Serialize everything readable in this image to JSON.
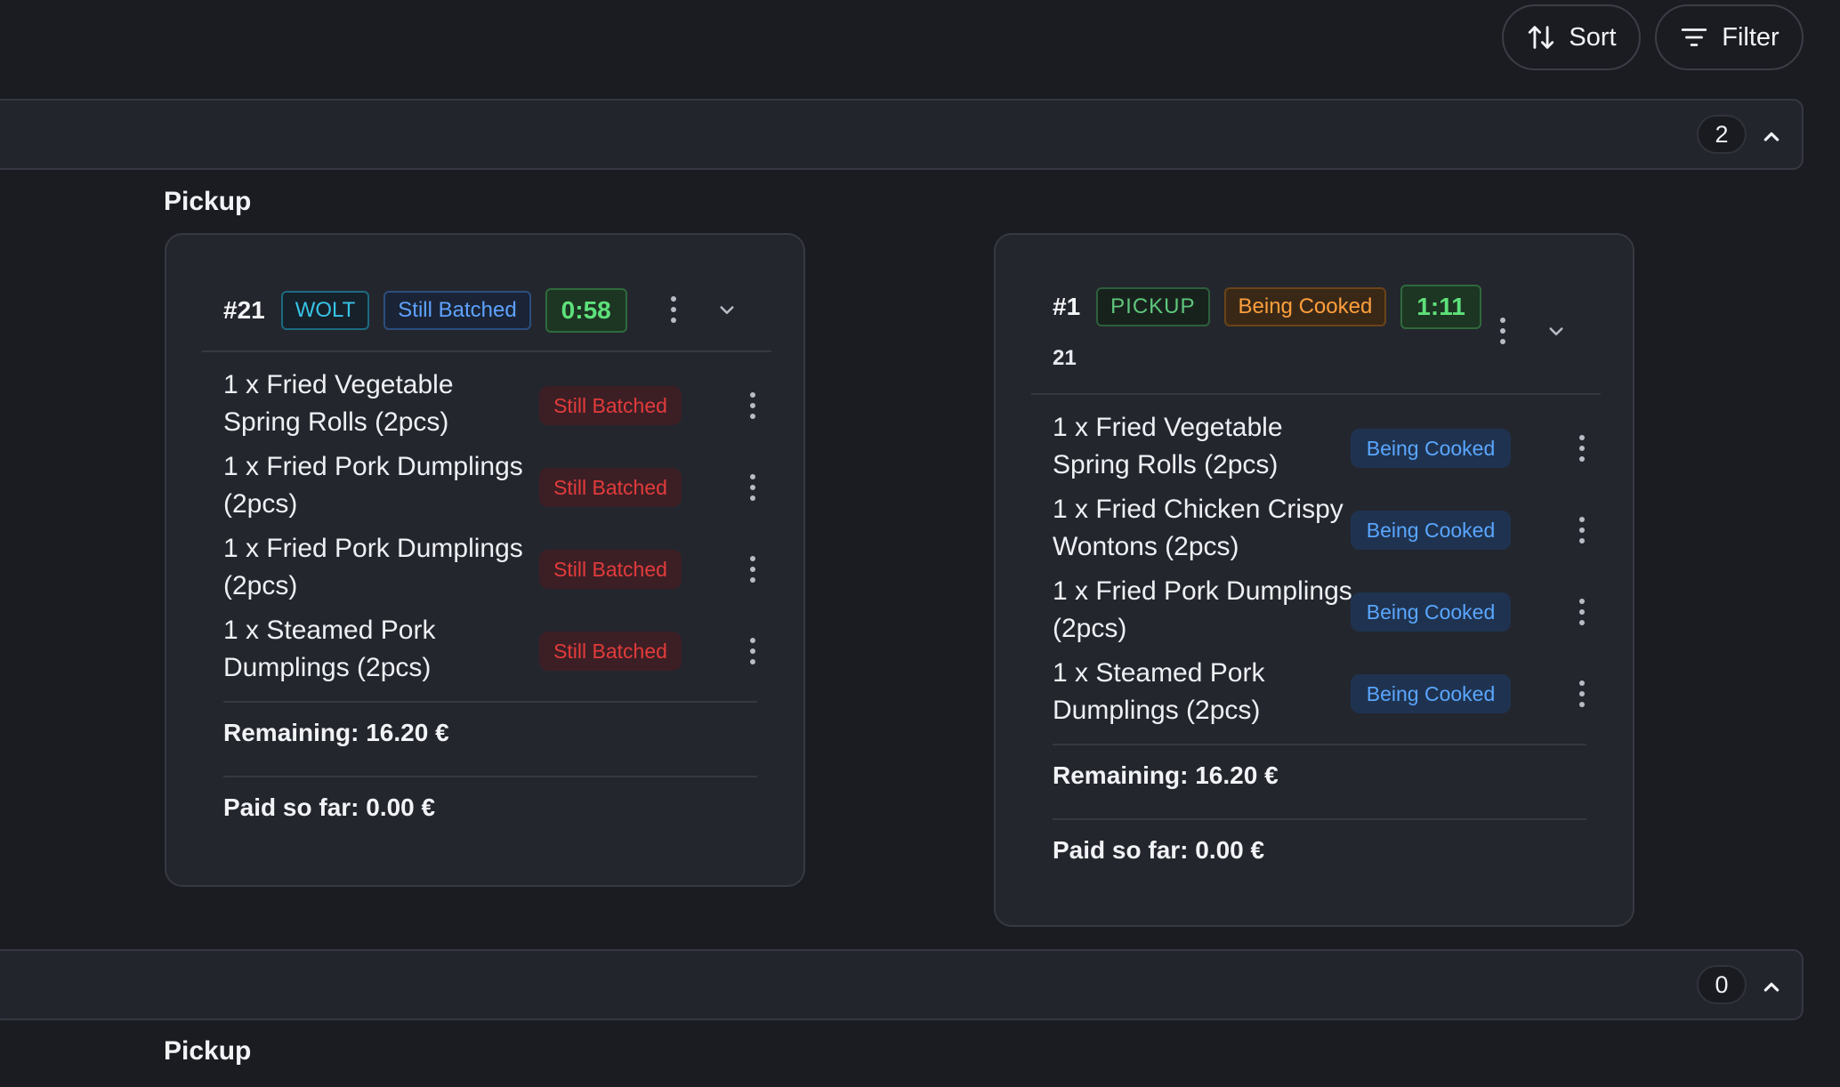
{
  "toolbar": {
    "sort_label": "Sort",
    "filter_label": "Filter"
  },
  "groups": [
    {
      "count": "2",
      "section_title": "Pickup",
      "orders": [
        {
          "number": "#21",
          "source_tag": "WOLT",
          "status_tag": "Still Batched",
          "timer": "0:58",
          "items": [
            {
              "name": "1 x Fried Vegetable Spring Rolls (2pcs)",
              "status": "Still Batched"
            },
            {
              "name": "1 x Fried Pork Dumplings (2pcs)",
              "status": "Still Batched"
            },
            {
              "name": "1 x Fried Pork Dumplings (2pcs)",
              "status": "Still Batched"
            },
            {
              "name": "1 x Steamed Pork Dumplings (2pcs)",
              "status": "Still Batched"
            }
          ],
          "remaining": "Remaining: 16.20 €",
          "paid": "Paid so far: 0.00 €"
        },
        {
          "number": "#1",
          "sub": "21",
          "source_tag": "PICKUP",
          "status_tag": "Being Cooked",
          "timer": "1:11",
          "items": [
            {
              "name": "1 x Fried Vegetable Spring Rolls (2pcs)",
              "status": "Being Cooked"
            },
            {
              "name": "1 x Fried Chicken Crispy Wontons (2pcs)",
              "status": "Being Cooked"
            },
            {
              "name": "1 x Fried Pork Dumplings (2pcs)",
              "status": "Being Cooked"
            },
            {
              "name": "1 x Steamed Pork Dumplings (2pcs)",
              "status": "Being Cooked"
            }
          ],
          "remaining": "Remaining: 16.20 €",
          "paid": "Paid so far: 0.00 €"
        }
      ]
    },
    {
      "count": "0",
      "section_title": "Pickup"
    }
  ],
  "icons": {
    "sort": "sort-arrows-icon",
    "filter": "filter-lines-icon",
    "more": "kebab-menu-icon",
    "collapse": "chevron-up-icon",
    "expand": "chevron-down-icon"
  },
  "colors": {
    "background": "#1b1c22",
    "card": "#24262e",
    "wolt": "#38c3e6",
    "pickup": "#5ec77c",
    "batched_blue": "#5ea2ff",
    "batched_red": "#e23b3b",
    "cooking_orange": "#ff9f3c",
    "timer_green": "#5ee07a"
  }
}
